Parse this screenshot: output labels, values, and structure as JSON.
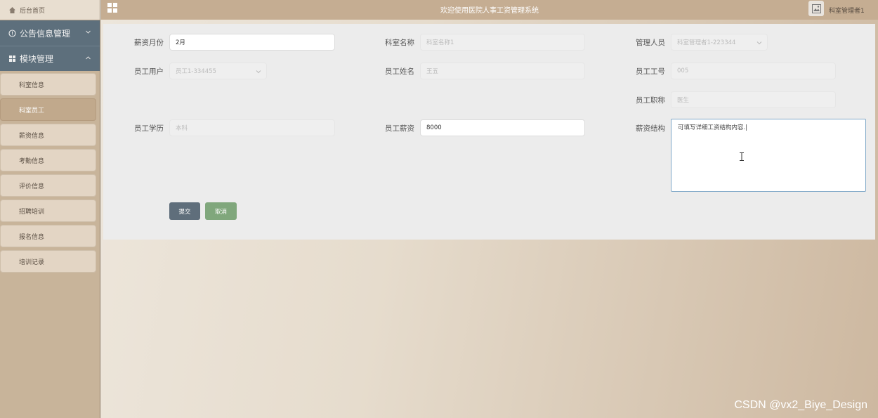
{
  "sidebar": {
    "home": "后台首页",
    "menus": [
      {
        "label": "公告信息管理"
      },
      {
        "label": "模块管理"
      }
    ],
    "items": [
      {
        "label": "科室信息"
      },
      {
        "label": "科室员工"
      },
      {
        "label": "薪资信息"
      },
      {
        "label": "考勤信息"
      },
      {
        "label": "评价信息"
      },
      {
        "label": "招聘培训"
      },
      {
        "label": "报名信息"
      },
      {
        "label": "培训记录"
      }
    ],
    "active_item": "科室员工"
  },
  "header": {
    "title": "欢迎使用医院人事工资管理系统",
    "user": "科室管理者1"
  },
  "form": {
    "salary_month": {
      "label": "薪资月份",
      "value": "2月"
    },
    "dept_name": {
      "label": "科室名称",
      "value": "科室名称1"
    },
    "manager": {
      "label": "管理人员",
      "value": "科室管理者1-223344"
    },
    "employee_user": {
      "label": "员工用户",
      "value": "员工1-334455"
    },
    "employee_name": {
      "label": "员工姓名",
      "value": "王五"
    },
    "employee_no": {
      "label": "员工工号",
      "value": "005"
    },
    "employee_title": {
      "label": "员工职称",
      "value": "医生"
    },
    "education": {
      "label": "员工学历",
      "value": "本科"
    },
    "salary": {
      "label": "员工薪资",
      "value": "8000"
    },
    "salary_structure": {
      "label": "薪资结构",
      "value": "可填写详细工资结构内容.|"
    },
    "submit_label": "提交",
    "cancel_label": "取消"
  },
  "watermark": "CSDN @vx2_Biye_Design"
}
